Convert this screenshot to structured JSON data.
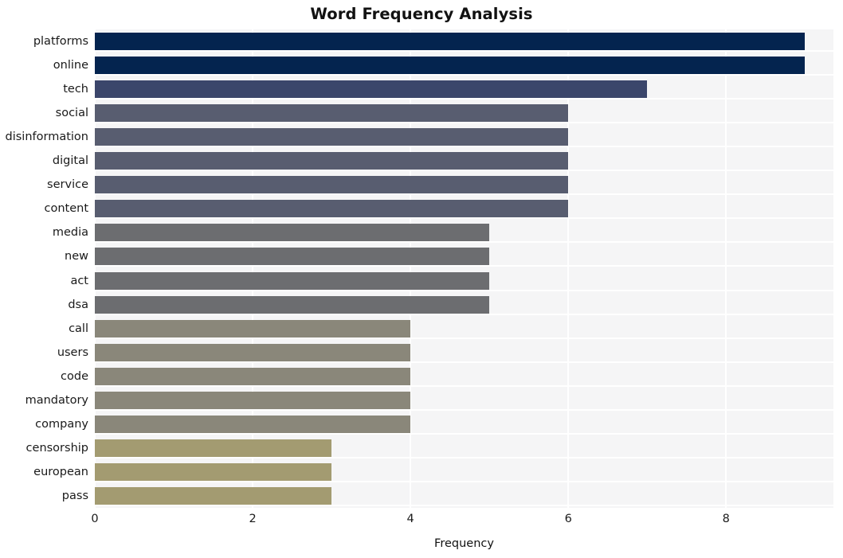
{
  "chart_data": {
    "type": "bar",
    "orientation": "horizontal",
    "title": "Word Frequency Analysis",
    "xlabel": "Frequency",
    "ylabel": "",
    "categories": [
      "platforms",
      "online",
      "tech",
      "social",
      "disinformation",
      "digital",
      "service",
      "content",
      "media",
      "new",
      "act",
      "dsa",
      "call",
      "users",
      "code",
      "mandatory",
      "company",
      "censorship",
      "european",
      "pass"
    ],
    "values": [
      9,
      9,
      7,
      6,
      6,
      6,
      6,
      6,
      5,
      5,
      5,
      5,
      4,
      4,
      4,
      4,
      4,
      3,
      3,
      3
    ],
    "bar_colors": [
      "#04244f",
      "#04244f",
      "#3b466b",
      "#585d70",
      "#585d70",
      "#585d70",
      "#585d70",
      "#585d70",
      "#6c6d70",
      "#6c6d70",
      "#6c6d70",
      "#6c6d70",
      "#8a877a",
      "#8a877a",
      "#8a877a",
      "#8a877a",
      "#8a877a",
      "#a39b71",
      "#a39b71",
      "#a39b71"
    ],
    "xlim": [
      0,
      9.36
    ],
    "xticks": [
      0,
      2,
      4,
      6,
      8
    ],
    "xtick_labels": [
      "0",
      "2",
      "4",
      "6",
      "8"
    ],
    "grid": "vertical-white",
    "legend": "none",
    "plot_background": "#f5f5f6",
    "figure_background": "#ffffff"
  }
}
